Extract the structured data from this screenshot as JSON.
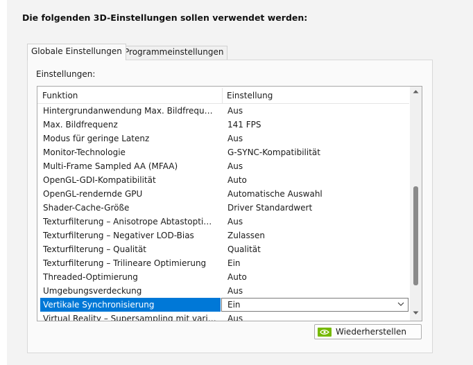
{
  "heading": "Die folgenden 3D-Einstellungen sollen verwendet werden:",
  "tabs": [
    {
      "label": "Globale Einstellungen",
      "active": true
    },
    {
      "label": "Programmeinstellungen",
      "active": false
    }
  ],
  "section_label": "Einstellungen:",
  "table": {
    "columns": [
      "Funktion",
      "Einstellung"
    ],
    "rows": [
      {
        "function": "Hintergrundanwendung Max. Bildfrequenz",
        "value": "Aus"
      },
      {
        "function": "Max. Bildfrequenz",
        "value": "141 FPS"
      },
      {
        "function": "Modus für geringe Latenz",
        "value": "Aus"
      },
      {
        "function": "Monitor-Technologie",
        "value": "G-SYNC-Kompatibilität"
      },
      {
        "function": "Multi-Frame Sampled AA (MFAA)",
        "value": "Aus"
      },
      {
        "function": "OpenGL-GDI-Kompatibilität",
        "value": "Auto"
      },
      {
        "function": "OpenGL-rendernde GPU",
        "value": "Automatische Auswahl"
      },
      {
        "function": "Shader-Cache-Größe",
        "value": "Driver Standardwert"
      },
      {
        "function": "Texturfilterung – Anisotrope Abtastoptimierung",
        "value": "Aus"
      },
      {
        "function": "Texturfilterung – Negativer LOD-Bias",
        "value": "Zulassen"
      },
      {
        "function": "Texturfilterung – Qualität",
        "value": "Qualität"
      },
      {
        "function": "Texturfilterung – Trilineare Optimierung",
        "value": "Ein"
      },
      {
        "function": "Threaded-Optimierung",
        "value": "Auto"
      },
      {
        "function": "Umgebungsverdeckung",
        "value": "Aus"
      },
      {
        "function": "Vertikale Synchronisierung",
        "value": "Ein",
        "selected": true
      },
      {
        "function": "Virtual Reality – Supersampling mit variabler Rate",
        "value": "Aus"
      }
    ]
  },
  "restore_button": {
    "label": "Wiederherstellen"
  },
  "colors": {
    "selection": "#0078d7",
    "nvidia_green": "#76b900"
  },
  "icons": [
    "nvidia-logo-icon",
    "chevron-down-icon",
    "scroll-up-arrow-icon",
    "scroll-down-arrow-icon"
  ]
}
